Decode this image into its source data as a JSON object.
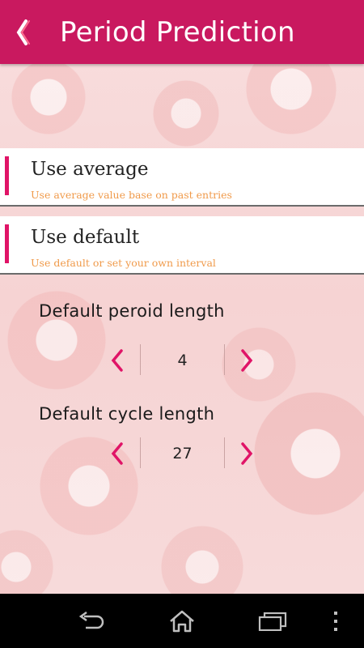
{
  "header": {
    "title": "Period Prediction",
    "back_icon": "chevron-left-icon",
    "color": "#c9195f"
  },
  "options": [
    {
      "label": "Use average",
      "subtitle": "Use average value base on past entries"
    },
    {
      "label": "Use default",
      "subtitle": "Use default or set your own interval"
    }
  ],
  "settings": {
    "period_length": {
      "label": "Default peroid length",
      "value": "4"
    },
    "cycle_length": {
      "label": "Default cycle length",
      "value": "27"
    }
  },
  "colors": {
    "accent": "#e01467",
    "subtitle": "#f09a4a"
  },
  "navbar": {
    "back_icon": "back-icon",
    "home_icon": "home-icon",
    "recents_icon": "recents-icon",
    "menu_icon": "menu-icon"
  }
}
